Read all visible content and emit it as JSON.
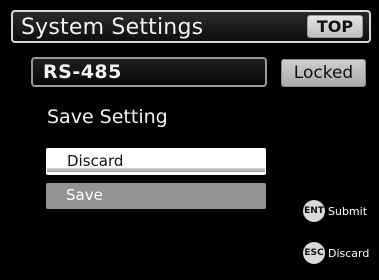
{
  "header": {
    "title": "System Settings",
    "top_button": "TOP"
  },
  "port": {
    "name": "RS-485",
    "status": "Locked"
  },
  "section": {
    "label": "Save Setting"
  },
  "options": [
    {
      "label": "Discard",
      "selected": true
    },
    {
      "label": "Save",
      "selected": false
    }
  ],
  "hints": [
    {
      "key": "ENT",
      "action": "Submit",
      "icon": "ent-key-icon"
    },
    {
      "key": "ESC",
      "action": "Discard",
      "icon": "esc-key-icon"
    }
  ],
  "colors": {
    "background": "#000000",
    "highlight": "#ffffff",
    "option": "#939393",
    "badge": "#bdbdbd"
  }
}
